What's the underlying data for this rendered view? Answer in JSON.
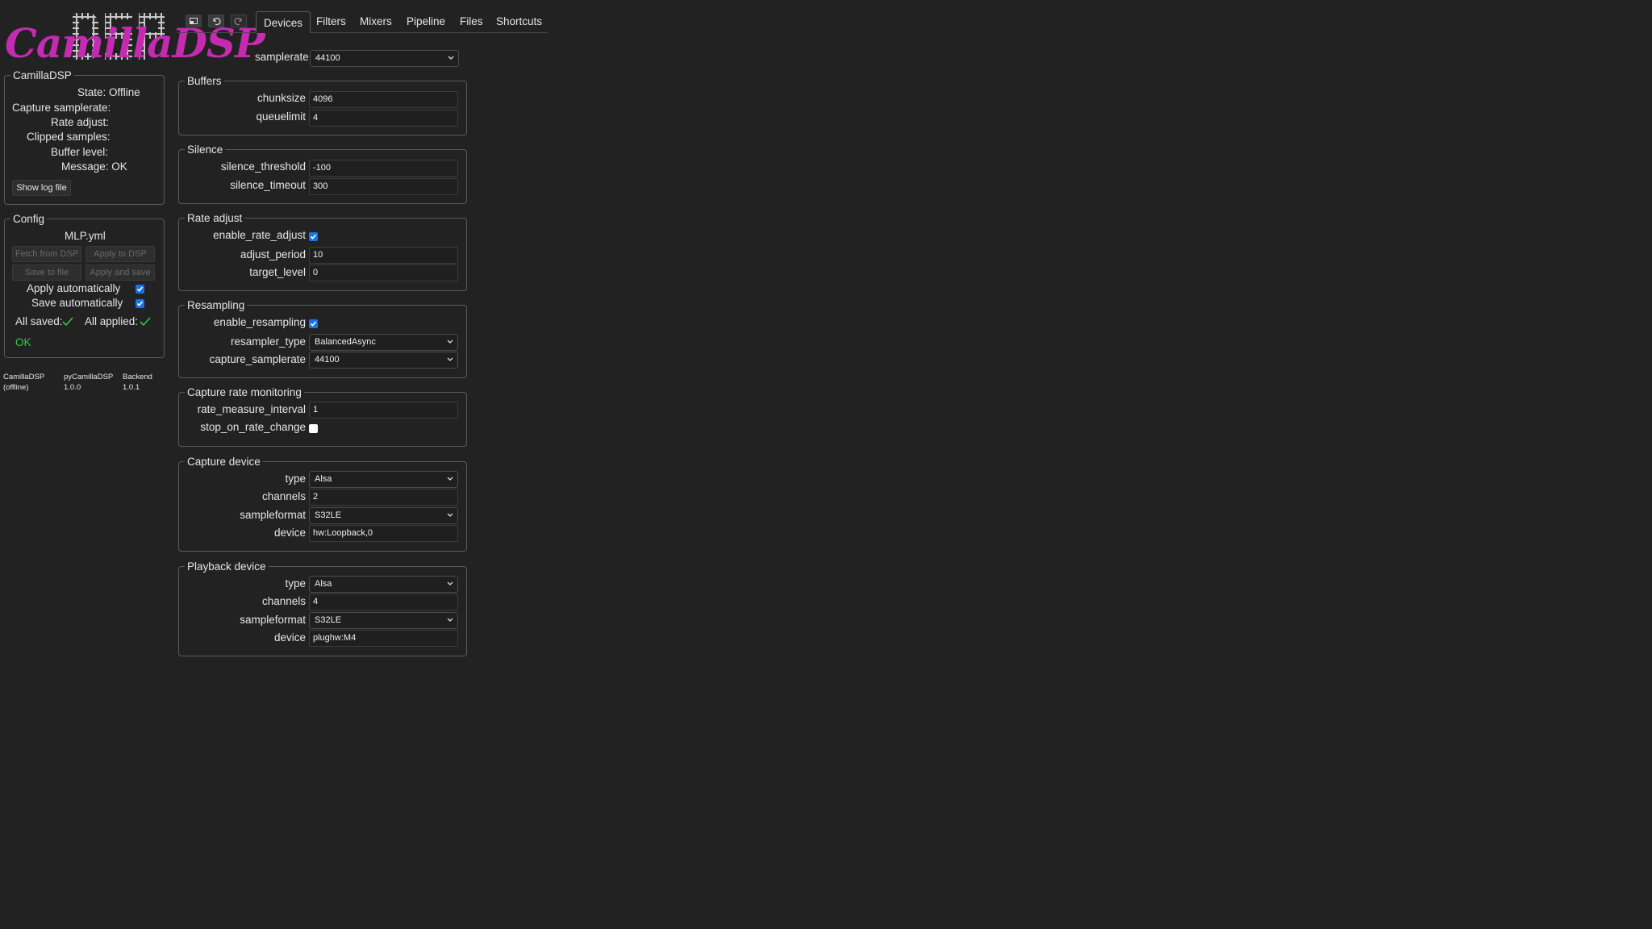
{
  "logo": {
    "text": "CamillaDSP"
  },
  "toolbar": {
    "icons": [
      "minimize-window-icon",
      "undo-icon",
      "redo-icon"
    ]
  },
  "tabs": [
    "Devices",
    "Filters",
    "Mixers",
    "Pipeline",
    "Files",
    "Shortcuts"
  ],
  "active_tab": "Devices",
  "status": {
    "legend": "CamillaDSP",
    "state_label": "State:",
    "state_value": "Offline",
    "capture_samplerate_label": "Capture samplerate:",
    "rate_adjust_label": "Rate adjust:",
    "clipped_samples_label": "Clipped samples:",
    "buffer_level_label": "Buffer level:",
    "message_label": "Message:",
    "message_value": "OK",
    "show_log_label": "Show log file"
  },
  "config": {
    "legend": "Config",
    "filename": "MLP.yml",
    "fetch_label": "Fetch from DSP",
    "apply_label": "Apply to DSP",
    "save_label": "Save to file",
    "apply_save_label": "Apply and save",
    "apply_auto_label": "Apply automatically",
    "apply_auto": true,
    "save_auto_label": "Save automatically",
    "save_auto": true,
    "all_saved_label": "All saved:",
    "all_applied_label": "All applied:",
    "ok_text": "OK",
    "ok_color": "#2ecc40"
  },
  "versions": {
    "camilladsp_name": "CamillaDSP",
    "camilladsp_value": "(offline)",
    "pycamilladsp_name": "pyCamillaDSP",
    "pycamilladsp_value": "1.0.0",
    "backend_name": "Backend",
    "backend_value": "1.0.1"
  },
  "devices": {
    "samplerate_label": "samplerate",
    "samplerate": "44100",
    "buffers": {
      "legend": "Buffers",
      "chunksize_label": "chunksize",
      "chunksize": "4096",
      "queuelimit_label": "queuelimit",
      "queuelimit": "4"
    },
    "silence": {
      "legend": "Silence",
      "threshold_label": "silence_threshold",
      "threshold": "-100",
      "timeout_label": "silence_timeout",
      "timeout": "300"
    },
    "rate_adjust": {
      "legend": "Rate adjust",
      "enable_label": "enable_rate_adjust",
      "enable": true,
      "period_label": "adjust_period",
      "period": "10",
      "target_label": "target_level",
      "target": "0"
    },
    "resampling": {
      "legend": "Resampling",
      "enable_label": "enable_resampling",
      "enable": true,
      "type_label": "resampler_type",
      "type": "BalancedAsync",
      "capture_samplerate_label": "capture_samplerate",
      "capture_samplerate": "44100"
    },
    "rate_monitoring": {
      "legend": "Capture rate monitoring",
      "interval_label": "rate_measure_interval",
      "interval": "1",
      "stop_label": "stop_on_rate_change",
      "stop": false
    },
    "capture": {
      "legend": "Capture device",
      "type_label": "type",
      "type": "Alsa",
      "channels_label": "channels",
      "channels": "2",
      "format_label": "sampleformat",
      "format": "S32LE",
      "device_label": "device",
      "device": "hw:Loopback,0"
    },
    "playback": {
      "legend": "Playback device",
      "type_label": "type",
      "type": "Alsa",
      "channels_label": "channels",
      "channels": "4",
      "format_label": "sampleformat",
      "format": "S32LE",
      "device_label": "device",
      "device": "plughw:M4"
    }
  },
  "colors": {
    "background": "#222222",
    "logo": "#c42bb0",
    "checkbox": "#1a73e8",
    "ok": "#2ecc40"
  }
}
